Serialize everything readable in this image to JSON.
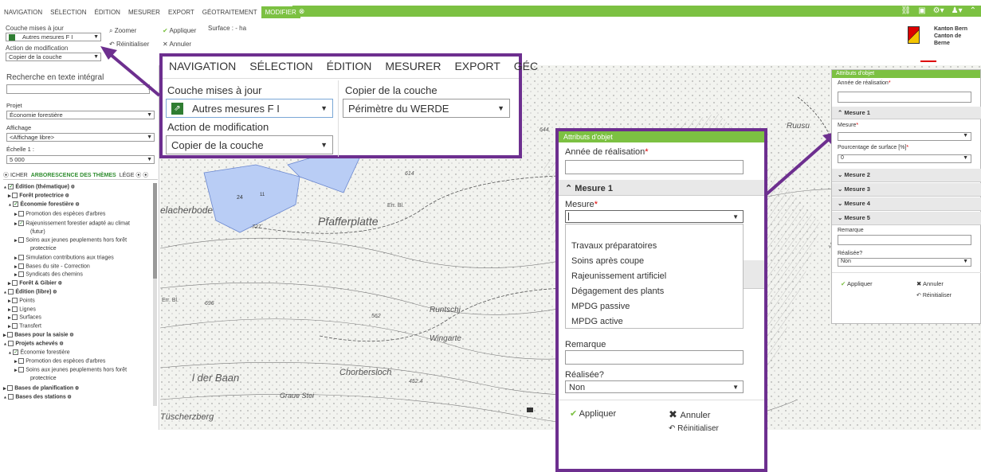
{
  "menu": {
    "items": [
      "NAVIGATION",
      "SÉLECTION",
      "ÉDITION",
      "MESURER",
      "EXPORT",
      "GÉOTRAITEMENT",
      "MODIFIER"
    ],
    "close": "⊗"
  },
  "ribbon": {
    "layer_label": "Couche mises à jour",
    "layer_value": "Autres mesures F I",
    "zoom": "Zoomer",
    "reset": "Réinitialiser",
    "apply": "Appliquer",
    "cancel": "Annuler",
    "surface": "Surface : - ha",
    "action_label": "Action de modification",
    "action_value": "Copier de la couche"
  },
  "logo": {
    "line1": "Kanton Bern",
    "line2": "Canton de Berne"
  },
  "sidebar": {
    "search_label": "Recherche en texte intégral",
    "project_label": "Projet",
    "project_value": "Économie forestière",
    "display_label": "Affichage",
    "display_value": "<Affichage libre>",
    "scale_label": "Échelle 1 :",
    "scale_value": "5 000",
    "tabs": [
      "ICHER",
      "ARBORESCENCE DES THÈMES",
      "LÉGE"
    ],
    "tree": [
      "Édition (thématique)",
      "Forêt protectrice",
      "Économie forestière",
      "Promotion des espèces d'arbres",
      "Rajeunissement forestier adapté au climat",
      "(futur)",
      "Soins aux jeunes peuplements hors forêt",
      "protectrice",
      "Simulation contributions aux triages",
      "Bases du site - Correction",
      "Syndicats des chemins",
      "Forêt & Gibier",
      "Édition (libre)",
      "Points",
      "Lignes",
      "Surfaces",
      "Transfert",
      "Bases pour la saisie",
      "Projets achevés",
      "Économie forestière",
      "Promotion des espèces d'arbres",
      "Soins aux jeunes peuplements hors forêt",
      "protectrice",
      "Bases de planification",
      "Bases des stations"
    ]
  },
  "map": {
    "labels": [
      "Pfafferplatte",
      "elacherbode",
      "Runtschi",
      "Wingarte",
      "l der Baan",
      "Chorbersloch",
      "Graue Stei",
      "Tüscherzberg",
      "Ruusu",
      "Err. Bl.",
      "Err. Bl."
    ],
    "numbers": [
      "24",
      "11",
      "727",
      "614",
      "644",
      "696",
      "562",
      "452.4"
    ]
  },
  "zoom": {
    "menu": [
      "NAVIGATION",
      "SÉLECTION",
      "ÉDITION",
      "MESURER",
      "EXPORT",
      "GÉC"
    ],
    "layer_label": "Couche mises à jour",
    "layer_value": "Autres mesures F I",
    "copy_label": "Copier de la couche",
    "copy_value": "Périmètre du WERDE",
    "action_label": "Action de modification",
    "action_value": "Copier de la couche"
  },
  "popup_big": {
    "title": "Attributs d'objet",
    "year_label": "Année de réalisation",
    "measure1": "Mesure 1",
    "measure_label": "Mesure",
    "options": [
      "Travaux préparatoires",
      "Soins après coupe",
      "Rajeunissement artificiel",
      "Dégagement des plants",
      "MPDG passive",
      "MPDG active"
    ],
    "remark_label": "Remarque",
    "done_label": "Réalisée?",
    "done_value": "Non",
    "apply": "Appliquer",
    "cancel": "Annuler",
    "reset": "Réinitialiser"
  },
  "popup_small": {
    "title": "Attributs d'objet",
    "year_label": "Année de réalisation",
    "measure1": "Mesure 1",
    "measure_label": "Mesure",
    "pct_label": "Pourcentage de surface [%]",
    "pct_value": "0",
    "measures": [
      "Mesure 2",
      "Mesure 3",
      "Mesure 4",
      "Mesure 5"
    ],
    "remark_label": "Remarque",
    "done_label": "Réalisée?",
    "done_value": "Non",
    "apply": "Appliquer",
    "cancel": "Annuler",
    "reset": "Réinitialiser"
  },
  "colors": {
    "accent": "#7cc142",
    "highlight": "#6d2f8f",
    "polygon": "#b9cdf5"
  }
}
